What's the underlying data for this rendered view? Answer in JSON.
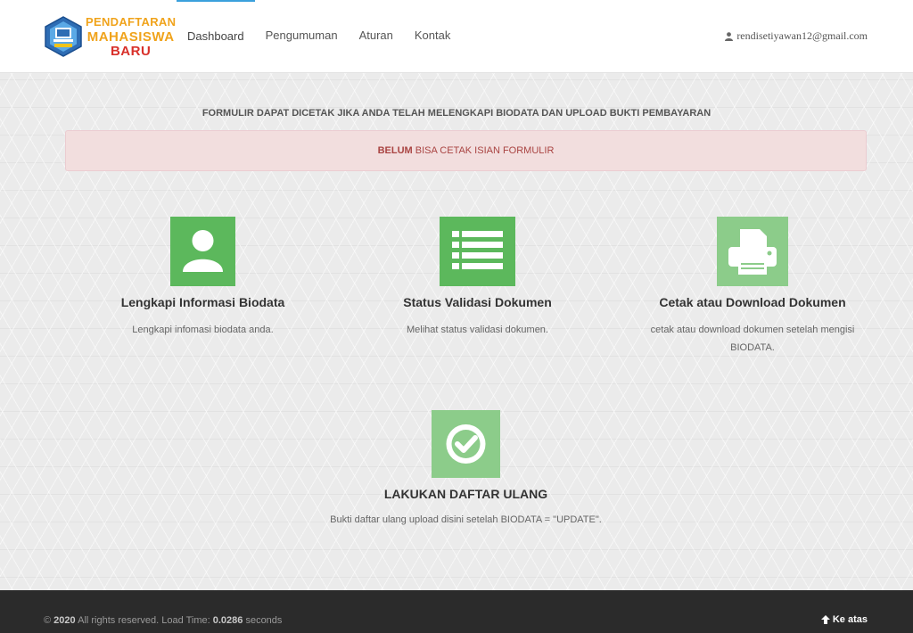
{
  "brand": {
    "line1": "PENDAFTARAN",
    "line2": "MAHASISWA",
    "line3": "BARU",
    "colors": {
      "primary": "#f0a31b",
      "secondary": "#d8302a",
      "emblem": "#2e6db4"
    }
  },
  "nav": {
    "items": [
      {
        "label": "Dashboard",
        "active": true
      },
      {
        "label": "Pengumuman"
      },
      {
        "label": "Aturan"
      },
      {
        "label": "Kontak"
      }
    ],
    "user_email": "rendisetiyawan12@gmail.com",
    "user_icon": "user-icon",
    "accent": "#3aa0dc"
  },
  "notice": "FORMULIR DAPAT DICETAK JIKA ANDA TELAH MELENGKAPI BIODATA DAN UPLOAD BUKTI PEMBAYARAN",
  "alert": {
    "strong": "BELUM",
    "text": " BISA CETAK ISIAN FORMULIR"
  },
  "features": [
    {
      "title": "Lengkapi Informasi Biodata",
      "desc": "Lengkapi infomasi biodata anda.",
      "icon": "user-icon"
    },
    {
      "title": "Status Validasi Dokumen",
      "desc": "Melihat status validasi dokumen.",
      "icon": "list-icon"
    },
    {
      "title": "Cetak atau Download Dokumen",
      "desc_line1": "cetak atau download dokumen setelah mengisi",
      "desc_line2": "BIODATA.",
      "icon": "print-icon"
    },
    {
      "title": "LAKUKAN DAFTAR ULANG",
      "desc": "Bukti daftar ulang upload disini setelah BIODATA = \"UPDATE\".",
      "icon": "check-circle-icon"
    }
  ],
  "footer": {
    "copyright_prefix": "© ",
    "year": "2020",
    "rights": " All rights reserved. Load Time: ",
    "load_time": "0.0286",
    "seconds": " seconds",
    "back_to_top": "Ke atas",
    "back_icon": "arrow-up-icon"
  },
  "colors": {
    "green": "#5cb85c",
    "green_light": "#8ccc8a",
    "alert_bg": "#f2dede",
    "alert_text": "#a94442",
    "footer_bg": "#2b2b2b"
  }
}
